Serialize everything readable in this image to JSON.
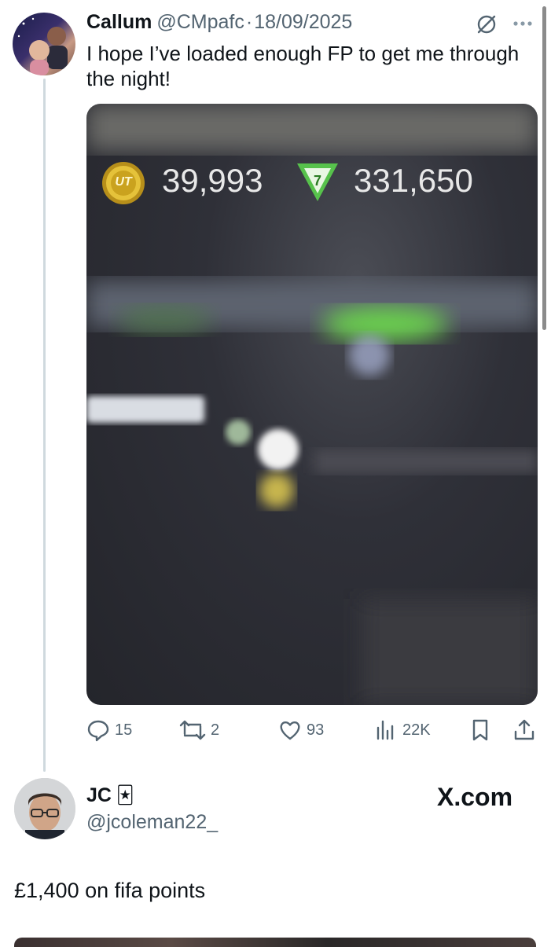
{
  "tweet": {
    "author_name": "Callum",
    "handle": "@CMpafc",
    "separator": "·",
    "date": "18/09/2025",
    "text": "I hope I’ve loaded enough FP to get me through the night!",
    "media": {
      "coins_badge": "UT",
      "coins_value": "39,993",
      "points_value": "331,650"
    },
    "actions": {
      "replies": "15",
      "reposts": "2",
      "likes": "93",
      "views": "22K"
    }
  },
  "reply": {
    "author_name": "JC",
    "author_emoji": "🃏",
    "handle": "@jcoleman22_",
    "watermark": "X.com",
    "text": "£1,400 on fifa points"
  },
  "colors": {
    "text": "#0f1419",
    "muted": "#536471",
    "thread_line": "#cfd9de",
    "points_green": "#57c24c",
    "coin_gold": "#d8b329"
  }
}
